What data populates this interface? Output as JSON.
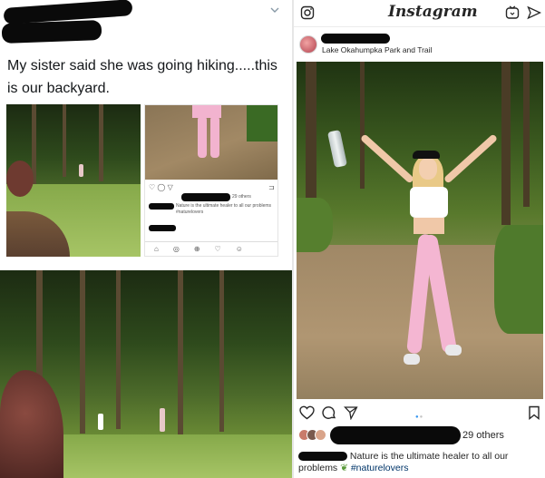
{
  "tweet": {
    "text": "My sister said she was going hiking.....this is our backyard.",
    "thumb": {
      "likes": "29 others",
      "caption": "Nature is the ultimate healer to all our problems #naturelovers"
    }
  },
  "instagram": {
    "logo": "Instagram",
    "post": {
      "location": "Lake Okahumpka Park and Trail",
      "likes_suffix": "29 others",
      "caption_text": "Nature is the ultimate healer to all our problems",
      "hashtag": "#naturelovers"
    }
  },
  "colors": {
    "leggings": "#f4b6d2",
    "link": "#3897f0",
    "redaction": "#0a0a0a"
  },
  "icons": [
    "camera-icon",
    "igtv-icon",
    "send-icon",
    "heart-icon",
    "comment-icon",
    "bookmark-icon",
    "chevron-down-icon"
  ]
}
